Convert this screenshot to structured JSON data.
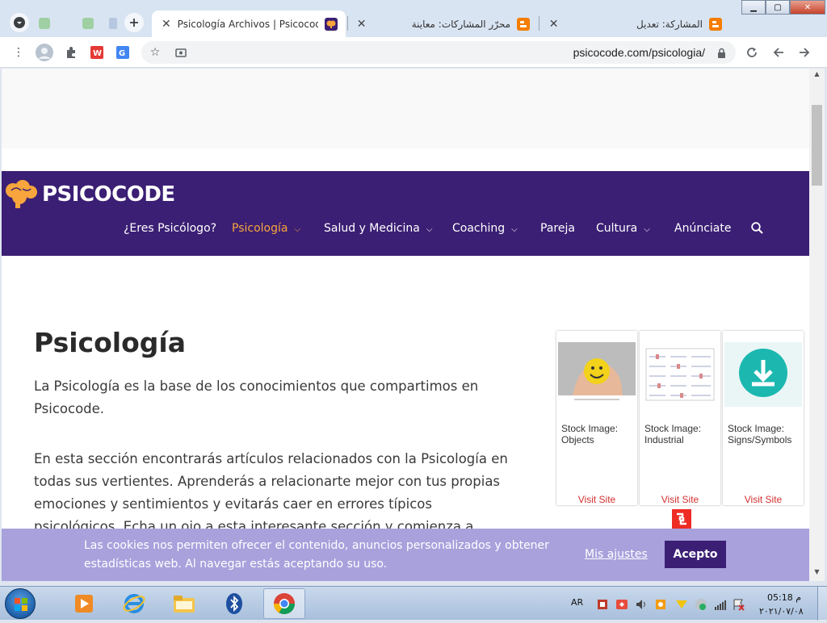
{
  "browser": {
    "tabs": [
      {
        "title": "Psicología Archivos | Psicocode",
        "active": true
      },
      {
        "title": "محرّر المشاركات: معاينة",
        "active": false
      },
      {
        "title": "المشاركة: تعديل",
        "active": false
      }
    ],
    "url": "psicocode.com/psicologia/"
  },
  "site": {
    "logo": "PSICOCODE",
    "nav": [
      {
        "label": "¿Eres Psicólogo?",
        "dropdown": false,
        "active": false
      },
      {
        "label": "Psicología",
        "dropdown": true,
        "active": true
      },
      {
        "label": "Salud y Medicina",
        "dropdown": true,
        "active": false
      },
      {
        "label": "Coaching",
        "dropdown": true,
        "active": false
      },
      {
        "label": "Pareja",
        "dropdown": false,
        "active": false
      },
      {
        "label": "Cultura",
        "dropdown": true,
        "active": false
      },
      {
        "label": "Anúnciate",
        "dropdown": false,
        "active": false
      }
    ]
  },
  "main": {
    "title": "Psicología",
    "paragraphs": [
      "La Psicología es la base de los conocimientos que compartimos en Psicocode.",
      "En esta sección encontrarás artículos relacionados con la Psicología en todas sus vertientes. Aprenderás a relacionarte mejor con tus propias emociones y sentimientos y evitarás caer en errores típicos psicológicos. Echa un ojo a esta interesante sección y comienza a entender tus"
    ]
  },
  "ads": {
    "cards": [
      {
        "caption": "Stock Image: Objects",
        "visit": "Visit Site"
      },
      {
        "caption": "Stock Image: Industrial",
        "visit": "Visit Site"
      },
      {
        "caption": "Stock Image: Signs/Symbols",
        "visit": "Visit Site"
      }
    ],
    "watermark": "shutterstock"
  },
  "cookie": {
    "text": "Las cookies nos permiten ofrecer el contenido, anuncios personalizados y obtener estadísticas web. Al navegar estás aceptando su uso.",
    "settings": "Mis ajustes",
    "accept": "Acepto"
  },
  "taskbar": {
    "lang": "AR",
    "time": "م 05:18",
    "date": "٢٠٢١/٠٧/٠٨"
  },
  "colors": {
    "brand": "#3b1f74",
    "accent": "#f7a53c",
    "cookie_bg": "#a8a1dc",
    "ad_visit": "#d32f2f"
  }
}
